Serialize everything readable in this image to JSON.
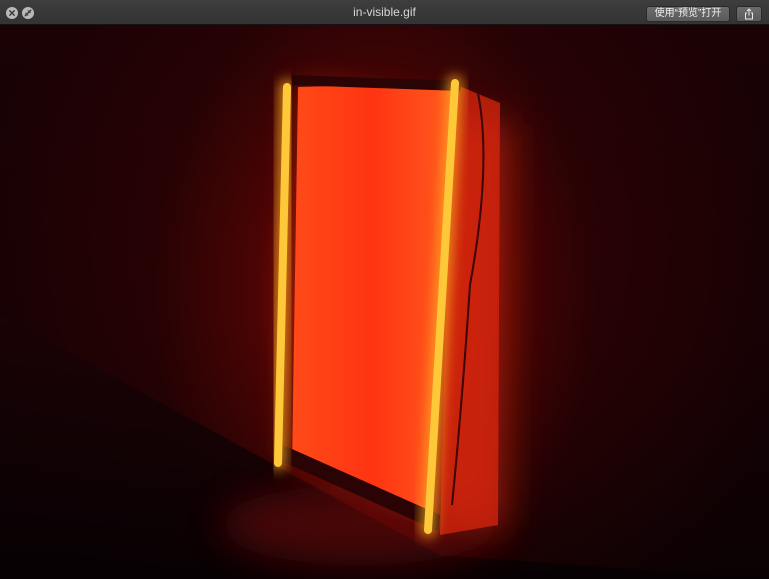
{
  "window": {
    "title": "in-visible.gif",
    "open_with_label": "使用“预览”打开"
  },
  "icons": {
    "close": "close-icon",
    "fullscreen": "fullscreen-icon",
    "share": "share-icon"
  },
  "image": {
    "subject": "neon-light-frame",
    "accent_color": "#ff3a10",
    "tube_color": "#ffb020"
  }
}
